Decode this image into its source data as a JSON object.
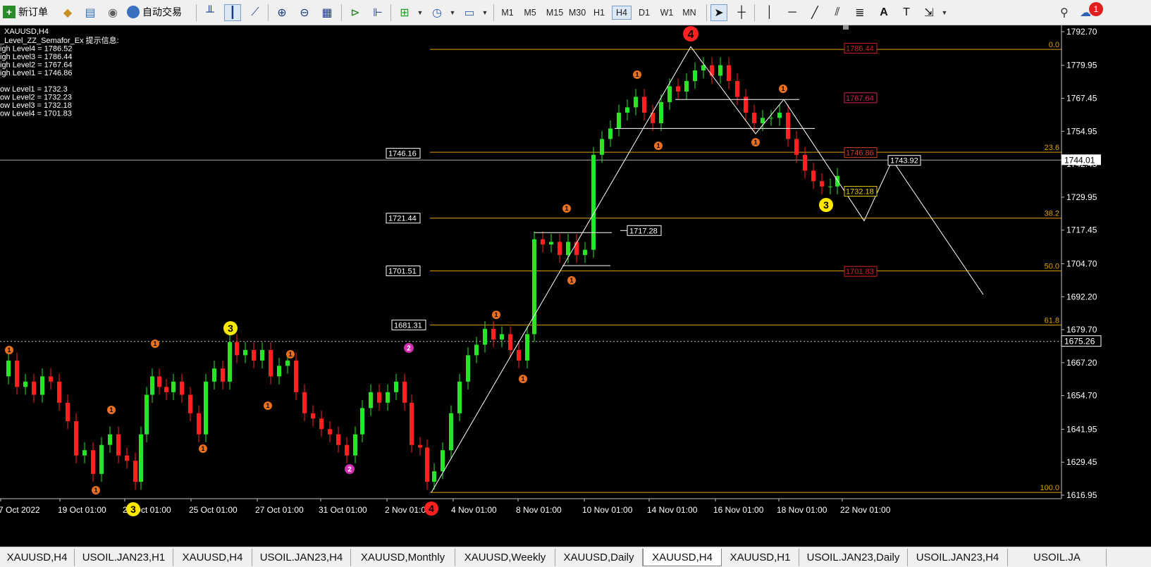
{
  "toolbar": {
    "new_order": "新订单",
    "auto_trade": "自动交易",
    "timeframes": [
      "M1",
      "M5",
      "M15",
      "M30",
      "H1",
      "H4",
      "D1",
      "W1",
      "MN"
    ],
    "active_timeframe": "H4",
    "notification_count": "1"
  },
  "chart": {
    "symbol_label": "XAUUSD,H4",
    "indicator_title": "_Level_ZZ_Semafor_Ex 提示信息:",
    "indicator_lines": [
      "igh Level4 = 1786.52",
      "igh Level3 = 1786.44",
      "igh Level2 = 1767.64",
      "igh Level1 = 1746.86",
      "",
      "ow Level1 = 1732.3",
      "ow Level2 = 1732.23",
      "ow Level3 = 1732.18",
      "ow Level4 = 1701.83"
    ],
    "price_axis": [
      "1792.70",
      "1779.95",
      "1767.45",
      "1754.95",
      "1742.45",
      "1729.95",
      "1717.45",
      "1704.70",
      "1692.20",
      "1679.70",
      "1667.20",
      "1654.70",
      "1641.95",
      "1629.45",
      "1616.95"
    ],
    "current_price": "1744.01",
    "dashed_price": "1675.26",
    "time_axis": [
      "7 Oct 2022",
      "19 Oct 01:00",
      "21 Oct 01:00",
      "25 Oct 01:00",
      "27 Oct 01:00",
      "31 Oct 01:00",
      "2 Nov 01:00",
      "4 Nov 01:00",
      "8 Nov 01:00",
      "10 Nov 01:00",
      "14 Nov 01:00",
      "16 Nov 01:00",
      "18 Nov 01:00",
      "22 Nov 01:00"
    ],
    "fib_levels": [
      {
        "label": "0.0",
        "price": 1786.0
      },
      {
        "label": "23.6",
        "price": 1747.0
      },
      {
        "label": "38.2",
        "price": 1722.0
      },
      {
        "label": "50.0",
        "price": 1702.0
      },
      {
        "label": "61.8",
        "price": 1681.5
      },
      {
        "label": "100.0",
        "price": 1618.0
      }
    ],
    "level_boxes_left": [
      "1746.16",
      "1721.44",
      "1701.51",
      "1681.31"
    ],
    "level_boxes_right": [
      "1786.44",
      "1767.64",
      "1746.86",
      "1732.18",
      "1701.83"
    ],
    "box_1717": "1717.28",
    "box_1743": "1743.92",
    "semafor_labels": [
      "4",
      "3",
      "3",
      "3",
      "2",
      "2",
      "1"
    ],
    "colors": {
      "up": "#27e627",
      "down": "#ff2020",
      "fib": "#e0a000",
      "semafor1": "#e87020",
      "semafor2": "#d030b0",
      "semafor3": "#ffe800",
      "semafor4": "#ff2020"
    }
  },
  "tabs": [
    "XAUUSD,H4",
    "USOIL.JAN23,H1",
    "XAUUSD,H4",
    "USOIL.JAN23,H4",
    "XAUUSD,Monthly",
    "XAUUSD,Weekly",
    "XAUUSD,Daily",
    "XAUUSD,H4",
    "XAUUSD,H1",
    "USOIL.JAN23,Daily",
    "USOIL.JAN23,H4",
    "USOIL.JA"
  ],
  "active_tab_index": 7
}
